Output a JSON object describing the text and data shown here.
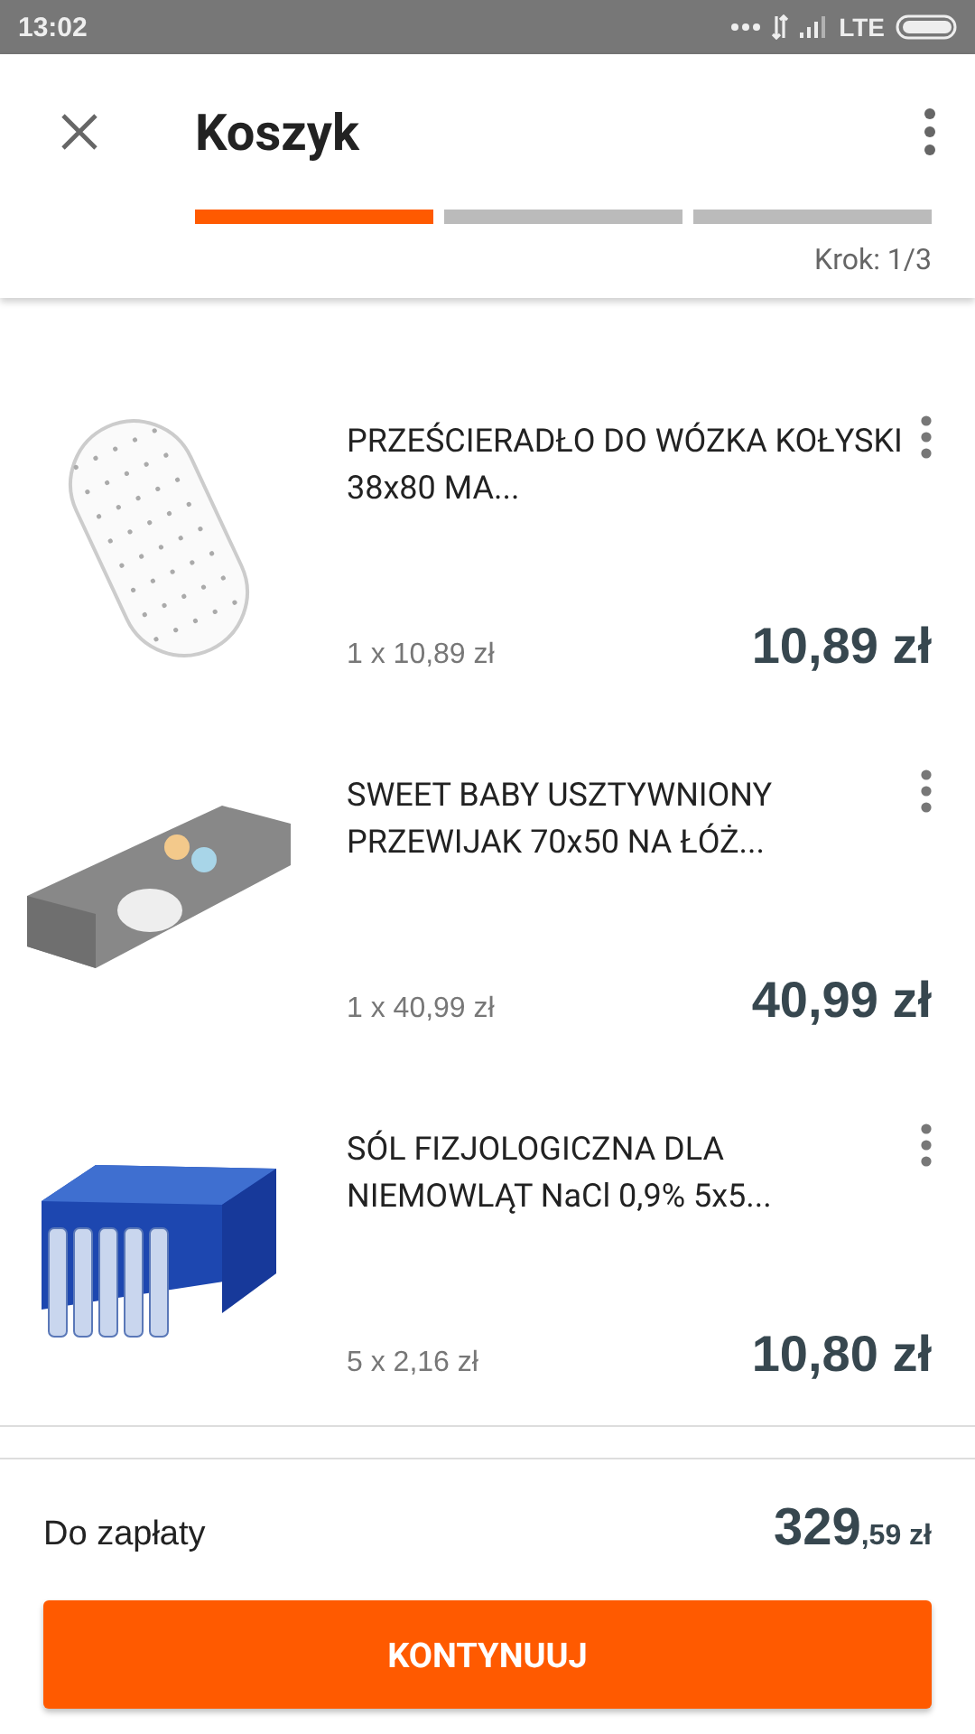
{
  "status_bar": {
    "time": "13:02",
    "network": "LTE"
  },
  "header": {
    "title": "Koszyk",
    "steps": [
      {
        "selected": true
      },
      {
        "selected": false
      },
      {
        "selected": false
      }
    ],
    "step_label": "Krok: 1/3"
  },
  "items": [
    {
      "kind": "sheet",
      "name": "PRZEŚCIERADŁO DO WÓZKA KOŁYSKI 38x80 MA...",
      "quantity": "1 x 10,89 zł",
      "total": "10,89 zł"
    },
    {
      "kind": "pad",
      "name": "SWEET BABY USZTYWNIONY PRZEWIJAK 70x50 NA ŁÓŻ...",
      "quantity": "1 x 40,99 zł",
      "total": "40,99 zł"
    },
    {
      "kind": "box",
      "name": "SÓL FIZJOLOGICZNA DLA NIEMOWLĄT NaCl 0,9% 5x5...",
      "quantity": "5 x 2,16 zł",
      "total": "10,80 zł"
    }
  ],
  "footer": {
    "label": "Do zapłaty",
    "total_main": "329",
    "total_fraction": ",59 zł",
    "button": "KONTYNUUJ"
  }
}
